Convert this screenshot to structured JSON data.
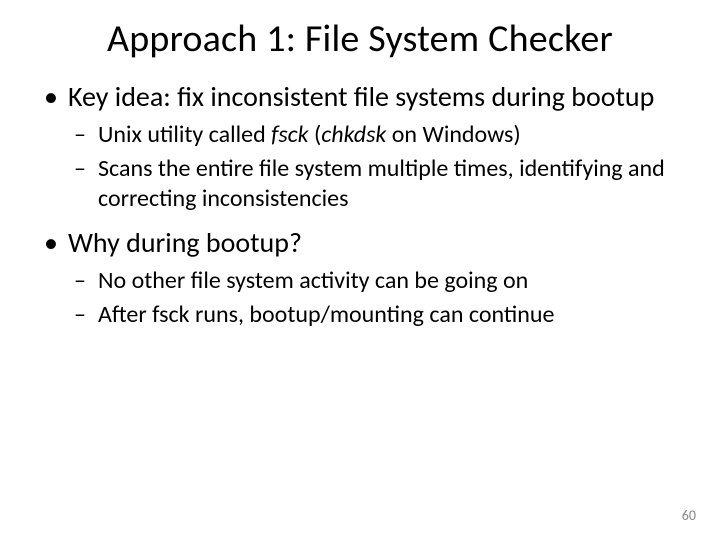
{
  "title": "Approach 1: File System Checker",
  "bullets": {
    "b1": "Key idea: fix inconsistent file systems during bootup",
    "b1_sub1_pre": "Unix utility called ",
    "b1_sub1_fsck": "fsck",
    "b1_sub1_mid": " (",
    "b1_sub1_chkdsk": "chkdsk",
    "b1_sub1_post": " on Windows)",
    "b1_sub2": "Scans the entire file system multiple times, identifying and correcting inconsistencies",
    "b2": "Why during bootup?",
    "b2_sub1": "No other file system activity can be going on",
    "b2_sub2": "After fsck runs, bootup/mounting can continue"
  },
  "page_number": "60"
}
